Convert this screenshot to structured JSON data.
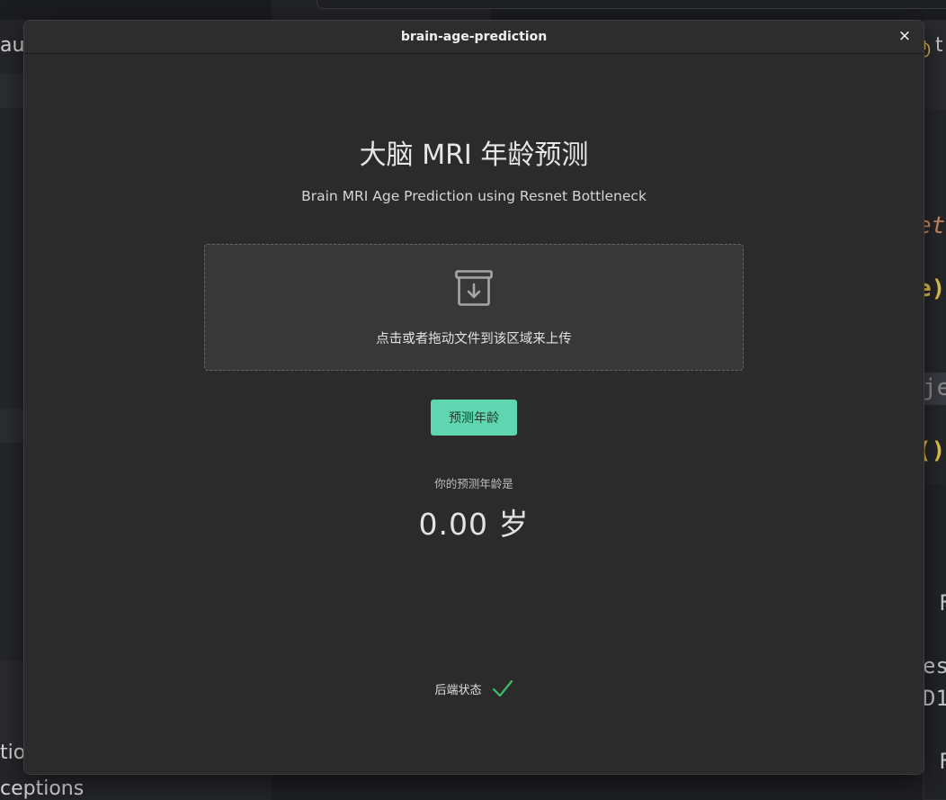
{
  "background": {
    "left_fragments": [
      "au",
      "tio",
      "ceptions"
    ],
    "right_fragments": [
      "et",
      "e)",
      "je",
      "()",
      "F",
      "es",
      "D1",
      "F"
    ],
    "top_right_fragment": "t"
  },
  "window": {
    "title": "brain-age-prediction",
    "close_symbol": "×"
  },
  "main": {
    "heading": "大脑 MRI 年龄预测",
    "subheading": "Brain MRI Age Prediction using Resnet Bottleneck",
    "dropzone": {
      "hint": "点击或者拖动文件到该区域来上传",
      "icon": "inbox-download-icon"
    },
    "predict_button": "预测年龄",
    "result": {
      "label": "你的预测年龄是",
      "value": "0.00 岁"
    },
    "status": {
      "label": "后端状态",
      "icon": "check-icon",
      "color": "#3fbf6f"
    }
  },
  "colors": {
    "button_bg": "#5fd6b0",
    "window_bg": "#2b2b2b",
    "dropzone_bg": "#383838"
  }
}
